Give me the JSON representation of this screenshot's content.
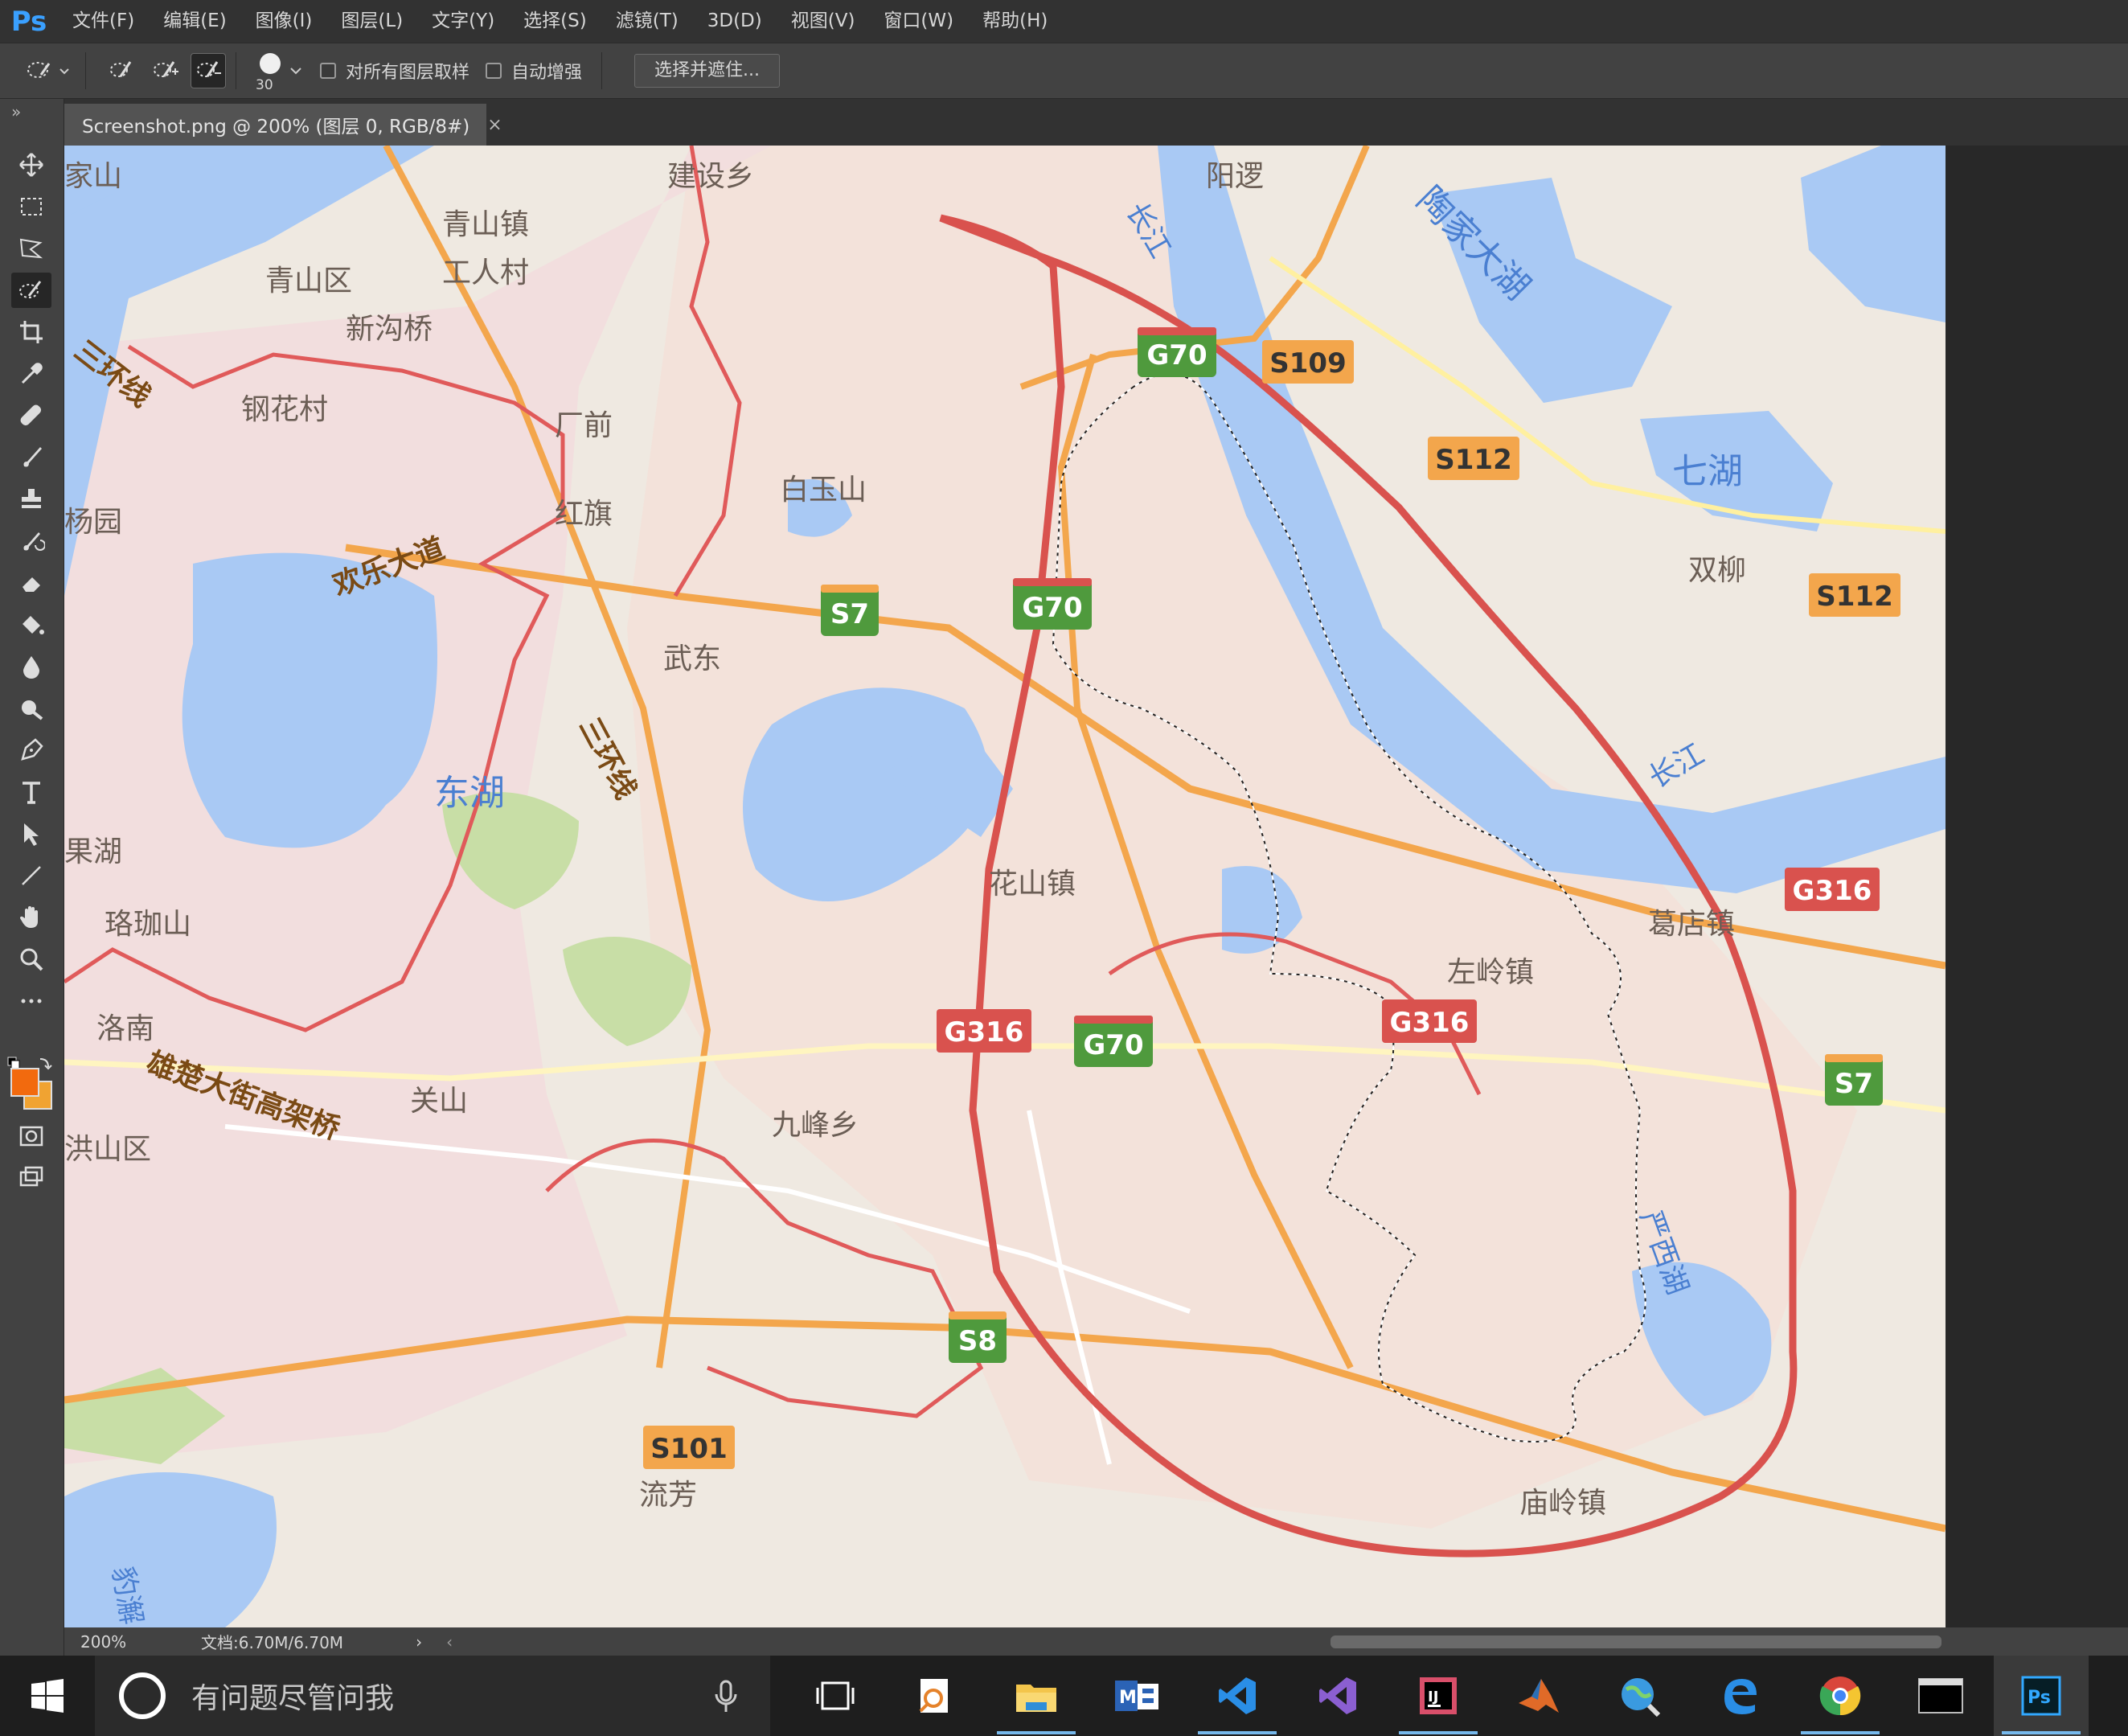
{
  "app": {
    "logo": "Ps",
    "menu": [
      "文件(F)",
      "编辑(E)",
      "图像(I)",
      "图层(L)",
      "文字(Y)",
      "选择(S)",
      "滤镜(T)",
      "3D(D)",
      "视图(V)",
      "窗口(W)",
      "帮助(H)"
    ]
  },
  "options": {
    "brush_size": "30",
    "sample_all_layers": "对所有图层取样",
    "auto_enhance": "自动增强",
    "select_and_mask": "选择并遮住..."
  },
  "document": {
    "tab_title": "Screenshot.png @ 200% (图层 0, RGB/8#)",
    "close": "×"
  },
  "status": {
    "zoom": "200%",
    "doc_size": "文档:6.70M/6.70M",
    "arrow": "›",
    "left_arrow": "‹"
  },
  "taskbar": {
    "search_placeholder": "有问题尽管问我"
  },
  "colors": {
    "foreground": "#f26a0e",
    "background": "#f0a332",
    "highway_green": "#4f9a3d",
    "highway_red": "#d9524e",
    "road_orange": "#f3a64c",
    "water": "#a9c9f4",
    "boundary": "#e05a5a"
  },
  "map": {
    "places": [
      {
        "id": "jiashan",
        "text": "家山"
      },
      {
        "id": "jiansheixiang",
        "text": "建设乡"
      },
      {
        "id": "yangluo",
        "text": "阳逻"
      },
      {
        "id": "taojiadahu",
        "text": "陶家大湖"
      },
      {
        "id": "qingshanzhen",
        "text": "青山镇"
      },
      {
        "id": "qingshanqu",
        "text": "青山区"
      },
      {
        "id": "gongrencun",
        "text": "工人村"
      },
      {
        "id": "xingouqiao",
        "text": "新沟桥"
      },
      {
        "id": "sanhuanxian1",
        "text": "三环线"
      },
      {
        "id": "ganghuacun",
        "text": "钢花村"
      },
      {
        "id": "changqian",
        "text": "厂前"
      },
      {
        "id": "baiyushan",
        "text": "白玉山"
      },
      {
        "id": "qihu",
        "text": "七湖"
      },
      {
        "id": "shuangliu",
        "text": "双柳"
      },
      {
        "id": "yangyuan",
        "text": "杨园"
      },
      {
        "id": "hongqi",
        "text": "红旗"
      },
      {
        "id": "huanledadao",
        "text": "欢乐大道"
      },
      {
        "id": "wudong",
        "text": "武东"
      },
      {
        "id": "changjiang1",
        "text": "长江"
      },
      {
        "id": "changjiang2",
        "text": "长江"
      },
      {
        "id": "donghu",
        "text": "东湖"
      },
      {
        "id": "sanhuanxian2",
        "text": "三环线"
      },
      {
        "id": "guohu",
        "text": "果湖"
      },
      {
        "id": "huashanzhen",
        "text": "花山镇"
      },
      {
        "id": "luojiashan",
        "text": "珞珈山"
      },
      {
        "id": "gedianzhen",
        "text": "葛店镇"
      },
      {
        "id": "zuolingzhen",
        "text": "左岭镇"
      },
      {
        "id": "luonan",
        "text": "洛南"
      },
      {
        "id": "xiongchu",
        "text": "雄楚大街高架桥"
      },
      {
        "id": "guanshan",
        "text": "关山"
      },
      {
        "id": "jiufengxiang",
        "text": "九峰乡"
      },
      {
        "id": "hongshanqu",
        "text": "洪山区"
      },
      {
        "id": "yanxihu",
        "text": "严西湖"
      },
      {
        "id": "liufang",
        "text": "流芳"
      },
      {
        "id": "miaolingzhen",
        "text": "庙岭镇"
      },
      {
        "id": "bali",
        "text": "豹澥"
      }
    ],
    "shields": [
      {
        "id": "g70-a",
        "text": "G70",
        "kind": "green"
      },
      {
        "id": "s109",
        "text": "S109",
        "kind": "orange"
      },
      {
        "id": "s112-a",
        "text": "S112",
        "kind": "orange"
      },
      {
        "id": "s112-b",
        "text": "S112",
        "kind": "orange"
      },
      {
        "id": "s7-a",
        "text": "S7",
        "kind": "green"
      },
      {
        "id": "g70-b",
        "text": "G70",
        "kind": "green"
      },
      {
        "id": "g316-a",
        "text": "G316",
        "kind": "red"
      },
      {
        "id": "g316-b",
        "text": "G316",
        "kind": "red"
      },
      {
        "id": "g70-c",
        "text": "G70",
        "kind": "green"
      },
      {
        "id": "g316-c",
        "text": "G316",
        "kind": "red"
      },
      {
        "id": "s7-b",
        "text": "S7",
        "kind": "green"
      },
      {
        "id": "s8",
        "text": "S8",
        "kind": "green"
      },
      {
        "id": "s101",
        "text": "S101",
        "kind": "orange"
      }
    ]
  }
}
